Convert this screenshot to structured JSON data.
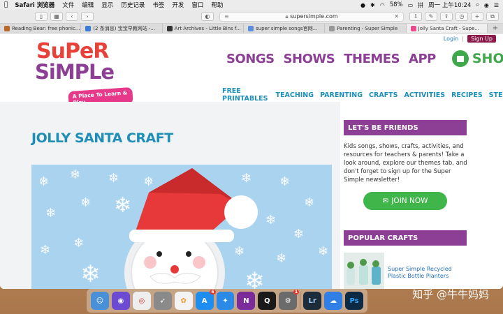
{
  "menubar": {
    "app": "Safari 浏览器",
    "items": [
      "文件",
      "编辑",
      "显示",
      "历史记录",
      "书签",
      "开发",
      "窗口",
      "帮助"
    ],
    "battery": "58%",
    "clock": "周一 上午10:24"
  },
  "browser": {
    "url": "supersimple.com",
    "tabs": [
      {
        "label": "Reading Bear: free phonic..."
      },
      {
        "label": "(2 条消息) 宝宝早教网站 -..."
      },
      {
        "label": "Art Archives - Little Bins f..."
      },
      {
        "label": "super simple songs官网..."
      },
      {
        "label": "Parenting - Super Simple"
      },
      {
        "label": "Jolly Santa Craft - Supe..."
      }
    ]
  },
  "site": {
    "logo": {
      "line1": "SuPeR",
      "line2": "SiMPLe",
      "tagline": "A Place To Learn & Play"
    },
    "login": "Login",
    "separator": "|",
    "signup": "Sign Up",
    "nav": [
      "SONGS",
      "SHOWS",
      "THEMES",
      "APP"
    ],
    "shop": "SHOP",
    "subnav": [
      "FREE PRINTABLES",
      "TEACHING",
      "PARENTING",
      "CRAFTS",
      "ACTIVITIES",
      "RECIPES",
      "STEM"
    ],
    "page_title": "JOLLY SANTA CRAFT",
    "sidebar": {
      "friends_heading": "LET'S BE FRIENDS",
      "friends_text": "Kids songs, shows, crafts, activities, and resources for teachers & parents! Take a look around, explore our themes tab, and don't forget to sign up for the Super Simple newsletter!",
      "join_button": "JOIN NOW",
      "popular_heading": "POPULAR CRAFTS",
      "popular_item": "Super Simple Recycled Plastic Bottle Planters"
    }
  },
  "dock": {
    "apps": [
      {
        "name": "finder",
        "color": "#4a90d9"
      },
      {
        "name": "siri",
        "color": "#6b4bd1"
      },
      {
        "name": "chrome",
        "color": "#e9e9e9"
      },
      {
        "name": "launchpad",
        "color": "#8a8a8a"
      },
      {
        "name": "photos",
        "color": "#f3f3f3"
      },
      {
        "name": "app-store",
        "color": "#1d8ef0",
        "badge": "6"
      },
      {
        "name": "safari",
        "color": "#2b8ae8"
      },
      {
        "name": "onenote",
        "color": "#7b2c9a"
      },
      {
        "name": "qq",
        "color": "#1a1a1a"
      },
      {
        "name": "system-preferences",
        "color": "#6b6b6b",
        "badge": "1"
      },
      {
        "name": "lightroom",
        "color": "#1d2c3b",
        "text": "Lr"
      },
      {
        "name": "baidu-netdisk",
        "color": "#2f7fe6"
      },
      {
        "name": "photoshop",
        "color": "#0c2a44",
        "text": "Ps"
      }
    ]
  },
  "watermark": "知乎 @牛牛妈妈"
}
